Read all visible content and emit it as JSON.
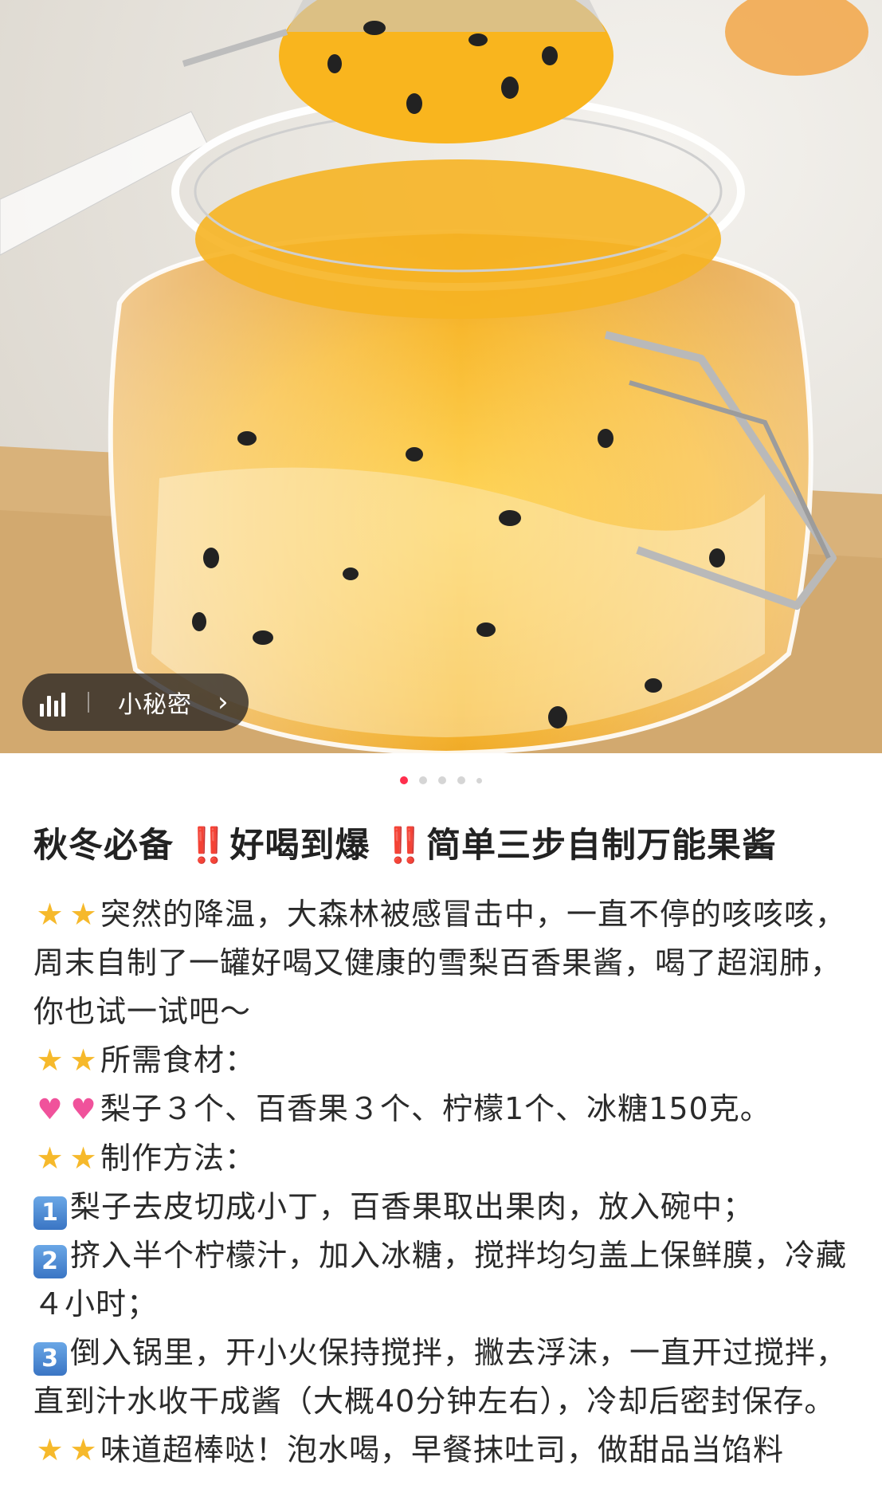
{
  "hero": {
    "tag_label": "小秘密",
    "carousel_total": 5,
    "carousel_active": 1
  },
  "post": {
    "title_part1": "秋冬必备",
    "title_part2": "好喝到爆",
    "title_part3": "简单三步自制万能果酱",
    "title_mark": "‼️",
    "intro": "突然的降温，大森林被感冒击中，一直不停的咳咳咳，周末自制了一罐好喝又健康的雪梨百香果酱，喝了超润肺，你也试一试吧～",
    "ingredients_heading": "所需食材：",
    "ingredients": "梨子３个、百香果３个、柠檬1个、冰糖150克。",
    "method_heading": "制作方法：",
    "step1_num": "1",
    "step1": "梨子去皮切成小丁，百香果取出果肉，放入碗中；",
    "step2_num": "2",
    "step2": "挤入半个柠檬汁，加入冰糖，搅拌均匀盖上保鲜膜，冷藏４小时；",
    "step3_num": "3",
    "step3": "倒入锅里，开小火保持搅拌，撇去浮沫，一直开过搅拌，直到汁水收干成酱（大概40分钟左右），冷却后密封保存。",
    "closing": "味道超棒哒！泡水喝，早餐抹吐司，做甜品当馅料"
  },
  "icons": {
    "star": "glowing-star-icon",
    "heart": "two-hearts-icon",
    "double_exclamation": "double-exclamation-icon"
  }
}
